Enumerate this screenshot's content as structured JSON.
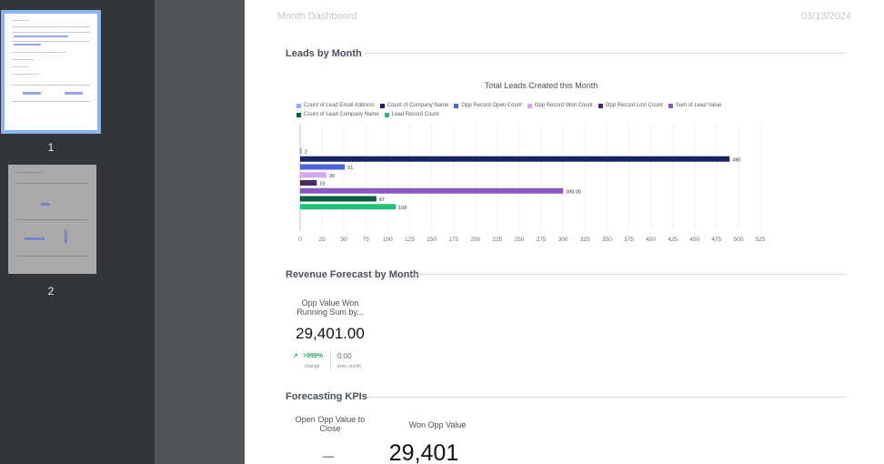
{
  "viewer": {
    "pages": [
      {
        "label": "1",
        "selected": true
      },
      {
        "label": "2",
        "selected": false
      }
    ]
  },
  "header": {
    "title": "Month Dashboard",
    "date": "03/13/2024"
  },
  "sections": {
    "leads": "Leads by Month",
    "revenue": "Revenue Forecast by Month",
    "forecast": "Forecasting KPIs"
  },
  "chart_data": {
    "type": "bar",
    "orientation": "horizontal",
    "title": "Total Leads Created this Month",
    "legend_position": "top",
    "grid": true,
    "xlim": [
      0,
      525
    ],
    "x_ticks": [
      "0",
      "25",
      "50",
      "75",
      "100",
      "125",
      "150",
      "175",
      "200",
      "225",
      "250",
      "275",
      "300",
      "325",
      "350",
      "375",
      "400",
      "425",
      "450",
      "475",
      "500",
      "525"
    ],
    "series": [
      {
        "name": "Count of Lead Email Address",
        "value": 2,
        "label": "2",
        "color": "#8fb1ee"
      },
      {
        "name": "Count of Company Name",
        "value": 490,
        "label": "490",
        "color": "#1b2462"
      },
      {
        "name": "Opp Record Open Count",
        "value": 51,
        "label": "51",
        "color": "#4d63d9"
      },
      {
        "name": "Opp Record Won Count",
        "value": 30,
        "label": "30",
        "color": "#d4a8ee"
      },
      {
        "name": "Opp Record Lost Count",
        "value": 19,
        "label": "19",
        "color": "#4a2a63"
      },
      {
        "name": "Sum of Lead Value",
        "value": 300,
        "label": "300.00",
        "color": "#8b58be"
      },
      {
        "name": "Count of Lead Company Name",
        "value": 87,
        "label": "87",
        "color": "#05613e"
      },
      {
        "name": "Lead Record Count",
        "value": 109,
        "label": "109",
        "color": "#22c07a"
      }
    ]
  },
  "revenue_kpi": {
    "label": "Opp Value Won Running Sum by...",
    "value": "29,401.00",
    "change": ">999%",
    "change_caption": "change",
    "prev_value": "0.00",
    "prev_caption": "prev. month"
  },
  "forecast_kpis": {
    "open_label": "Open Opp Value to Close",
    "open_value": "–",
    "won_label": "Won Opp Value",
    "won_value": "29,401"
  }
}
